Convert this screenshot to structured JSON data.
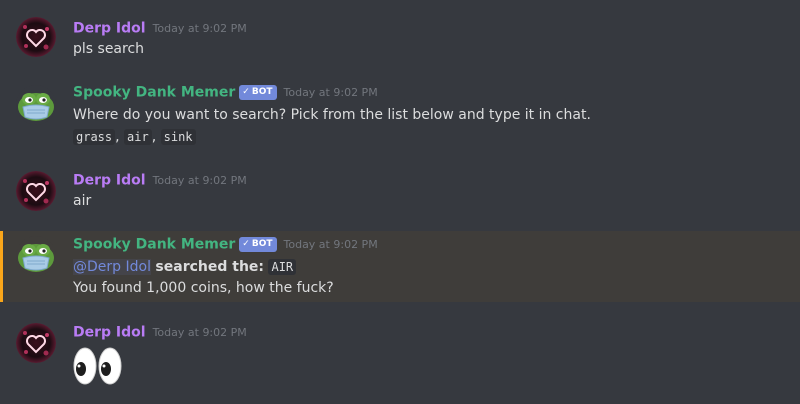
{
  "colors": {
    "background": "#36393f",
    "derp_name": "#b97cf5",
    "memer_name": "#43b581",
    "bot_tag": "#7289da",
    "highlight_border": "#faa61a",
    "highlight_bg": "#3f3d3a",
    "timestamp": "#72767d",
    "text": "#dcddde",
    "mention": "#7289da"
  },
  "bot_tag": {
    "check": "✓",
    "label": "BOT"
  },
  "messages": [
    {
      "author": "Derp Idol",
      "avatar": "heart-avatar-icon",
      "timestamp": "Today at 9:02 PM",
      "text": "pls search"
    },
    {
      "author": "Spooky Dank Memer",
      "avatar": "pepe-mask-avatar-icon",
      "bot": true,
      "timestamp": "Today at 9:02 PM",
      "text": "Where do you want to search? Pick from the list below and type it in chat.",
      "options": [
        "grass",
        "air",
        "sink"
      ],
      "separator": ","
    },
    {
      "author": "Derp Idol",
      "avatar": "heart-avatar-icon",
      "timestamp": "Today at 9:02 PM",
      "text": "air"
    },
    {
      "author": "Spooky Dank Memer",
      "avatar": "pepe-mask-avatar-icon",
      "bot": true,
      "highlighted": true,
      "timestamp": "Today at 9:02 PM",
      "mention": "@Derp Idol",
      "action": "searched the:",
      "location": "AIR",
      "result": "You found 1,000 coins, how the fuck?"
    },
    {
      "author": "Derp Idol",
      "avatar": "heart-avatar-icon",
      "timestamp": "Today at 9:02 PM",
      "emoji": "eyes-emoji"
    }
  ]
}
